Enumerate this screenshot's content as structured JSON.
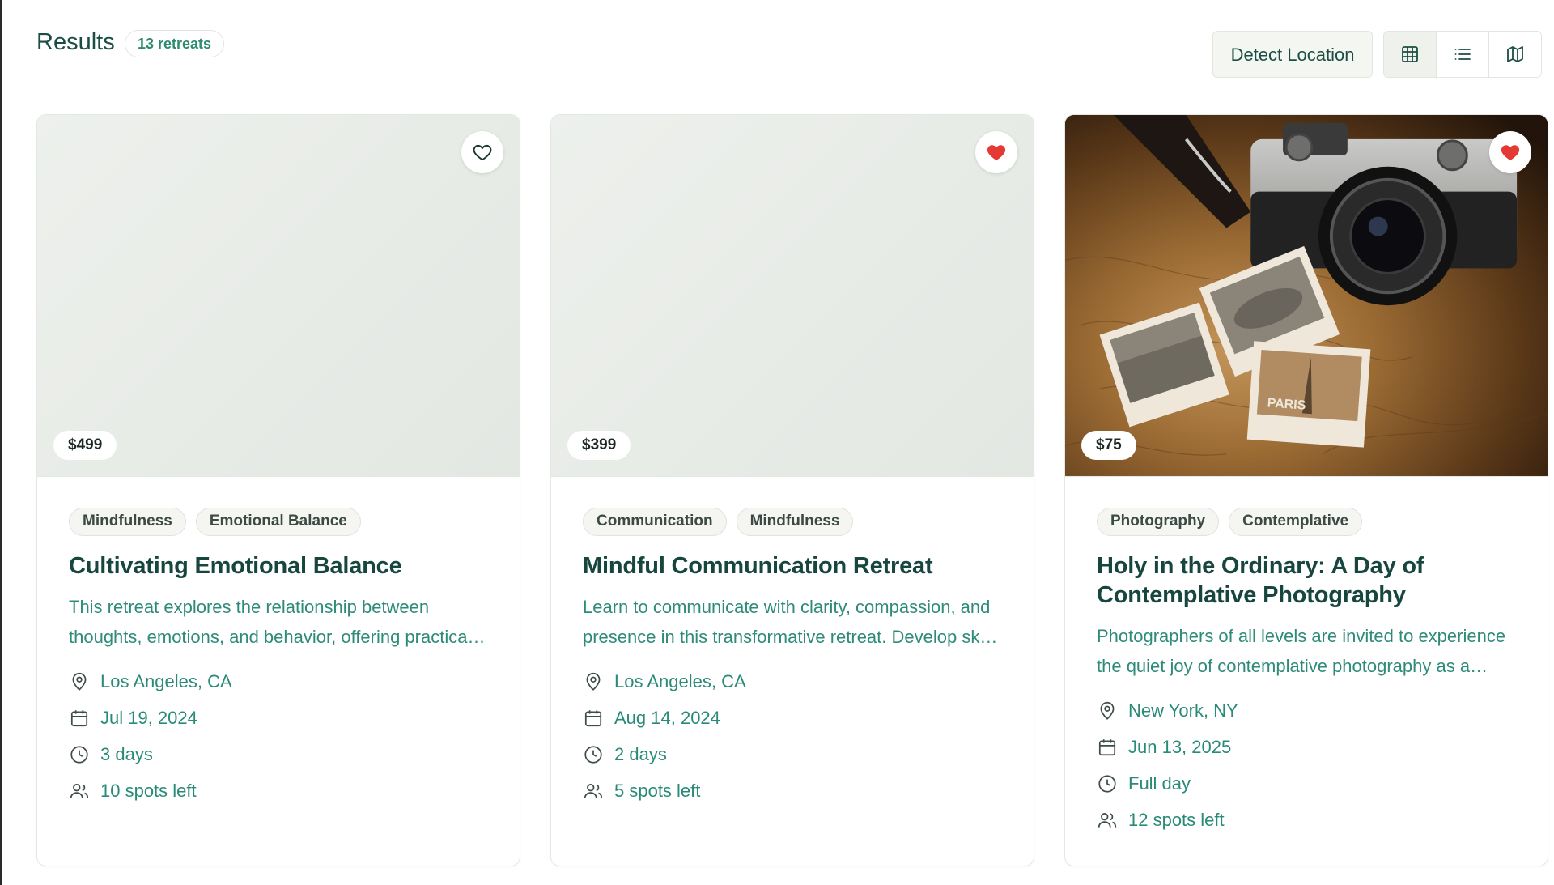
{
  "header": {
    "title": "Results",
    "count_badge": "13 retreats",
    "detect_location_label": "Detect Location",
    "view_modes": [
      {
        "name": "grid",
        "icon": "grid-icon",
        "active": true
      },
      {
        "name": "list",
        "icon": "list-icon",
        "active": false
      },
      {
        "name": "map",
        "icon": "map-icon",
        "active": false
      }
    ]
  },
  "colors": {
    "accent": "#2e8b7a",
    "title": "#17463f",
    "heart_active": "#e53935"
  },
  "cards": [
    {
      "price": "$499",
      "favorited": false,
      "has_photo": false,
      "tags": [
        "Mindfulness",
        "Emotional Balance"
      ],
      "title": "Cultivating Emotional Balance",
      "description": "This retreat explores the relationship between thoughts, emotions, and behavior, offering practical tools and insights for emotional wellbeing.",
      "location": "Los Angeles, CA",
      "date": "Jul 19, 2024",
      "duration": "3 days",
      "spots": "10 spots left"
    },
    {
      "price": "$399",
      "favorited": true,
      "has_photo": false,
      "tags": [
        "Communication",
        "Mindfulness"
      ],
      "title": "Mindful Communication Retreat",
      "description": "Learn to communicate with clarity, compassion, and presence in this transformative retreat. Develop skills for deeper connection.",
      "location": "Los Angeles, CA",
      "date": "Aug 14, 2024",
      "duration": "2 days",
      "spots": "5 spots left"
    },
    {
      "price": "$75",
      "favorited": true,
      "has_photo": true,
      "tags": [
        "Photography",
        "Contemplative"
      ],
      "title": "Holy in the Ordinary: A Day of Contemplative Photography",
      "description": "Photographers of all levels are invited to experience the quiet joy of contemplative photography as a spiritual practice.",
      "location": "New York, NY",
      "date": "Jun 13, 2025",
      "duration": "Full day",
      "spots": "12 spots left"
    }
  ]
}
